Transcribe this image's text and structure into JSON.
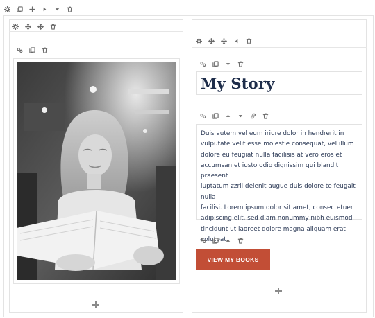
{
  "top_toolbar": {
    "icons": [
      "gear-icon",
      "duplicate-icon",
      "add-icon",
      "arrow-right-icon",
      "chevron-down-icon",
      "trash-icon"
    ]
  },
  "left_column": {
    "toolbar": {
      "icons": [
        "gear-icon",
        "move-icon",
        "move-icon",
        "trash-icon"
      ]
    },
    "image_module": {
      "toolbar": {
        "icons": [
          "settings-icon",
          "duplicate-icon",
          "trash-icon"
        ]
      },
      "image_description": "woman reading a book"
    }
  },
  "right_column": {
    "toolbar": {
      "icons": [
        "gear-icon",
        "move-icon",
        "move-icon",
        "arrow-left-icon",
        "trash-icon"
      ]
    },
    "heading_module": {
      "toolbar": {
        "icons": [
          "settings-icon",
          "duplicate-icon",
          "chevron-down-icon",
          "trash-icon"
        ]
      },
      "text": "My Story"
    },
    "text_module": {
      "toolbar": {
        "icons": [
          "settings-icon",
          "duplicate-icon",
          "chevron-up-icon",
          "chevron-down-icon",
          "link-icon",
          "trash-icon"
        ]
      },
      "text": "Duis autem vel eum iriure dolor in hendrerit in\nvulputate velit esse molestie consequat, vel illum\ndolore eu feugiat nulla facilisis at vero eros et\naccumsan et iusto odio dignissim qui blandit praesent\nluptatum zzril delenit augue duis dolore te feugait nulla\nfacilisi. Lorem ipsum dolor sit amet, consectetuer\nadipiscing elit, sed diam nonummy nibh euismod\ntincidunt ut laoreet dolore magna aliquam erat\nvolutpat."
    },
    "button_module": {
      "toolbar": {
        "icons": [
          "settings-icon",
          "duplicate-icon",
          "chevron-up-icon",
          "trash-icon"
        ]
      },
      "label": "VIEW MY BOOKS"
    }
  },
  "colors": {
    "button_bg": "#c24e36",
    "heading": "#1e2d4a",
    "body_text": "#2d3b57",
    "border": "#e3e3e3"
  }
}
